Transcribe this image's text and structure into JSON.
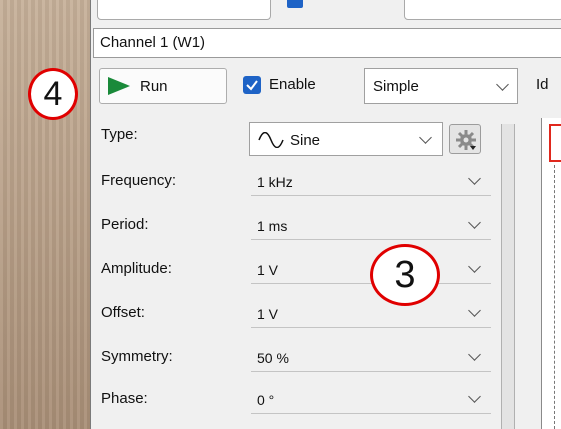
{
  "channel": {
    "title": "Channel 1 (W1)"
  },
  "toolbar": {
    "run_label": "Run",
    "enable_label": "Enable",
    "enable_checked": true,
    "mode_value": "Simple",
    "id_label": "Id"
  },
  "properties": [
    {
      "label": "Type:",
      "value": "Sine",
      "icon": "sine-wave-icon"
    },
    {
      "label": "Frequency:",
      "value": "1 kHz"
    },
    {
      "label": "Period:",
      "value": "1 ms"
    },
    {
      "label": "Amplitude:",
      "value": "1 V"
    },
    {
      "label": "Offset:",
      "value": "1 V"
    },
    {
      "label": "Symmetry:",
      "value": "50 %"
    },
    {
      "label": "Phase:",
      "value": "0 °"
    }
  ],
  "callouts": {
    "run": "4",
    "fields": "3"
  },
  "colors": {
    "accent": "#1e63c6",
    "play": "#1a8a3a",
    "callout_ring": "#e00000"
  }
}
